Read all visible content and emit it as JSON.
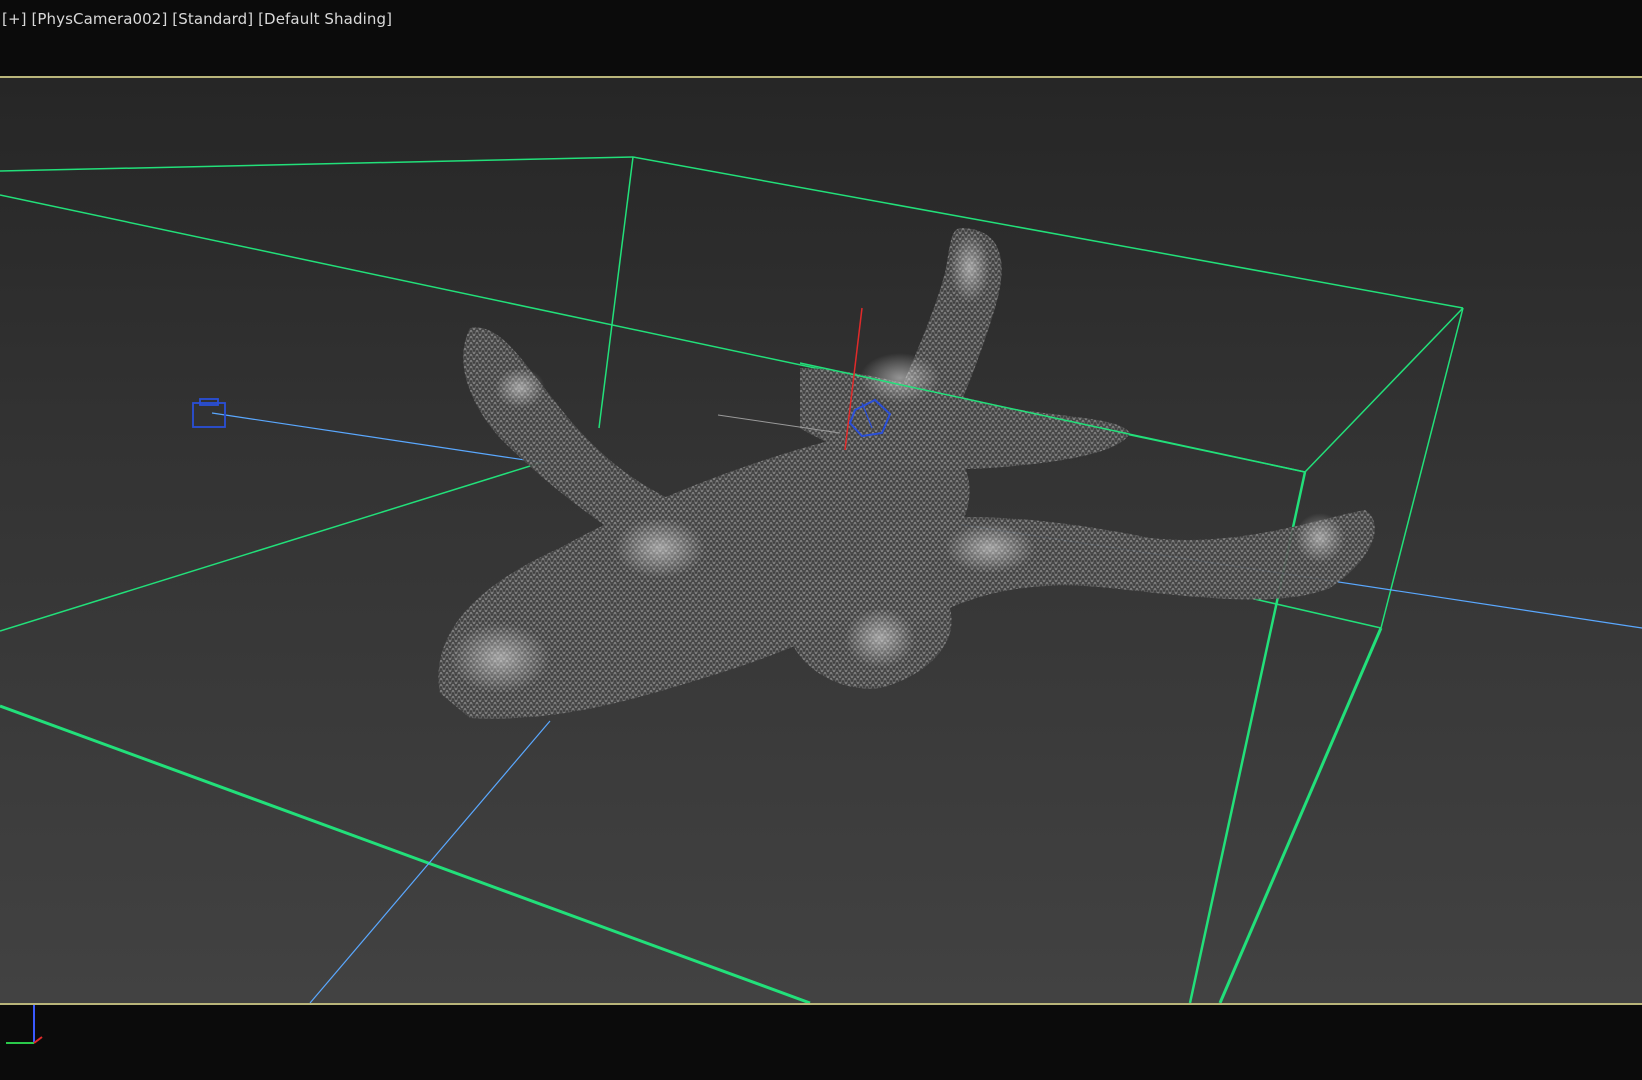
{
  "viewport": {
    "label_parts": [
      "[+]",
      "[PhysCamera002]",
      "[Standard]",
      "[Default Shading]"
    ]
  },
  "scene": {
    "colors": {
      "bounding_box": "#22e07a",
      "helper_lines": "#5aa8ff",
      "camera_icon": "#2a4fd8",
      "axis_z": "#e02a2a",
      "frame_border": "#b9b57a"
    },
    "icons": {
      "camera": "camera-icon",
      "pivot": "pivot-gizmo-icon",
      "world_axis": "axis-tripod-icon"
    }
  }
}
